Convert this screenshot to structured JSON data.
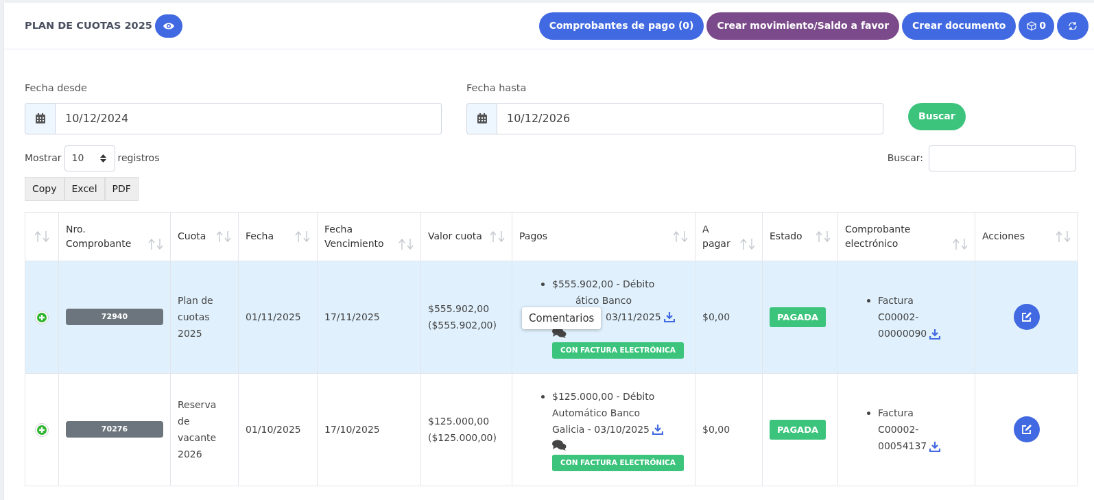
{
  "header": {
    "title": "PLAN DE CUOTAS 2025",
    "buttons": [
      {
        "label": "Comprobantes de pago (0)",
        "kind": "primary"
      },
      {
        "label": "Crear movimiento/Saldo a favor",
        "kind": "purple"
      },
      {
        "label": "Crear documento",
        "kind": "primary"
      },
      {
        "label": "0",
        "kind": "cube"
      },
      {
        "kind": "refresh"
      }
    ]
  },
  "filters": {
    "from": {
      "label": "Fecha desde",
      "value": "10/12/2024"
    },
    "to": {
      "label": "Fecha hasta",
      "value": "10/12/2026"
    },
    "search_button": "Buscar"
  },
  "length": {
    "before": "Mostrar",
    "value": "10",
    "after": "registros"
  },
  "search": {
    "label": "Buscar:"
  },
  "export_buttons": [
    "Copy",
    "Excel",
    "PDF"
  ],
  "table": {
    "columns": [
      "",
      "Nro. Comprobante",
      "Cuota",
      "Fecha",
      "Fecha Vencimiento",
      "Valor cuota",
      "Pagos",
      "A pagar",
      "Estado",
      "Comprobante electrónico",
      "Acciones"
    ],
    "rows": [
      {
        "selected": true,
        "number": "72940",
        "cuota": "Plan de cuotas 2025",
        "fecha": "01/11/2025",
        "vencimiento": "17/11/2025",
        "valor": "$555.902,00",
        "valor_paid": "($555.902,00)",
        "payment_lines": [
          "$555.902,00 - Débito",
          "ático Banco",
          "03/11/2025"
        ],
        "tooltip": "Comentarios",
        "payment_badge": "CON FACTURA ELECTRÓNICA",
        "a_pagar": "$0,00",
        "estado": "PAGADA",
        "invoice_lines": [
          "Factura",
          "C00002-",
          "00000090"
        ]
      },
      {
        "selected": false,
        "number": "70276",
        "cuota": "Reserva de vacante 2026",
        "fecha": "01/10/2025",
        "vencimiento": "17/10/2025",
        "valor": "$125.000,00",
        "valor_paid": "($125.000,00)",
        "payment_lines": [
          "$125.000,00 - Débito",
          "Automático Banco",
          "Galicia - 03/10/2025"
        ],
        "payment_badge": "CON FACTURA ELECTRÓNICA",
        "a_pagar": "$0,00",
        "estado": "PAGADA",
        "invoice_lines": [
          "Factura",
          "C00002-",
          "00054137"
        ]
      }
    ]
  }
}
